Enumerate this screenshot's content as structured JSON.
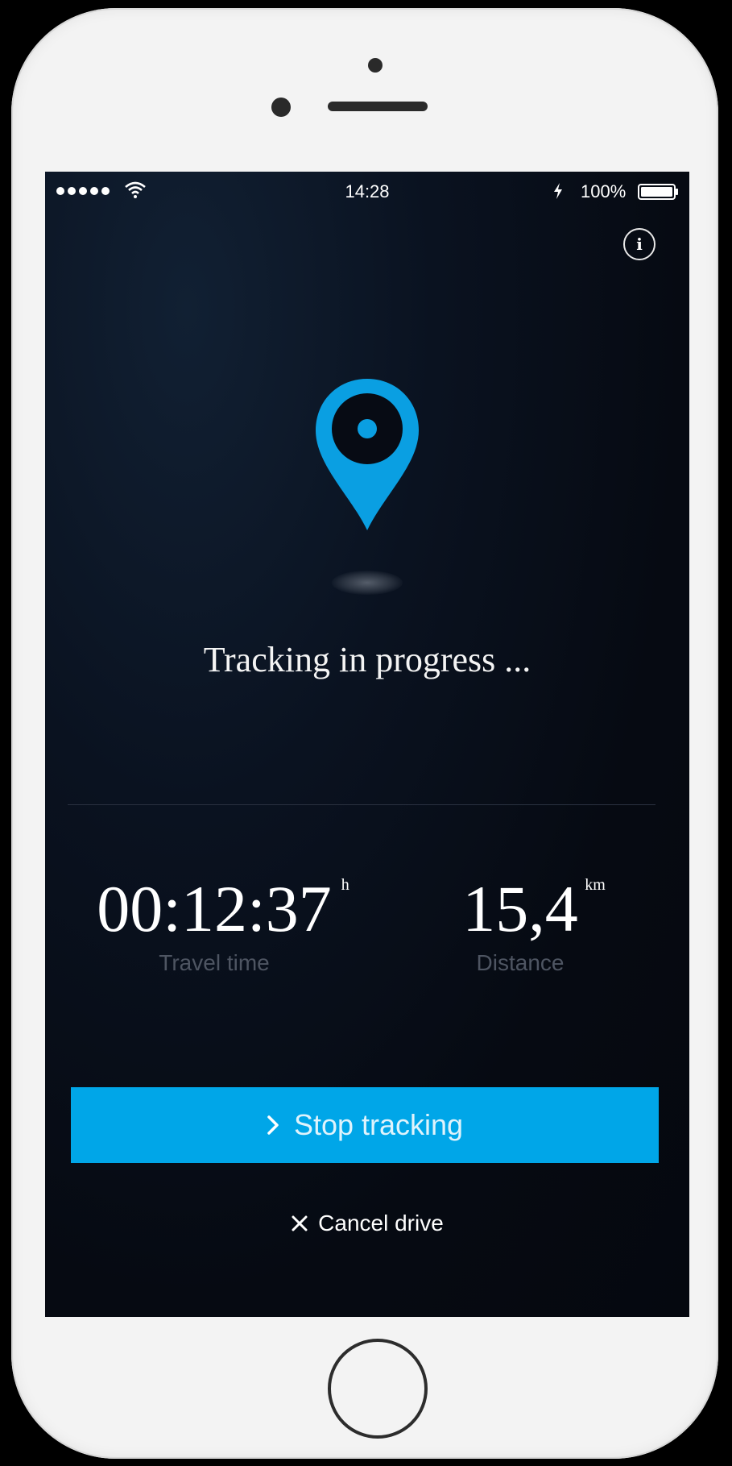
{
  "status_bar": {
    "time": "14:28",
    "battery": "100%"
  },
  "main": {
    "status_message": "Tracking in progress ...",
    "travel_time": {
      "value": "00:12:37",
      "unit": "h",
      "label": "Travel time"
    },
    "distance": {
      "value": "15,4",
      "unit": "km",
      "label": "Distance"
    }
  },
  "actions": {
    "stop_label": "Stop tracking",
    "cancel_label": "Cancel drive"
  },
  "colors": {
    "accent": "#00a6e8",
    "background": "#05080f",
    "device_frame": "#f3f3f3"
  },
  "icons": [
    "cellular-signal-icon",
    "wifi-icon",
    "charging-icon",
    "battery-icon",
    "info-icon",
    "location-pin-icon",
    "chevron-right-icon",
    "close-icon"
  ]
}
